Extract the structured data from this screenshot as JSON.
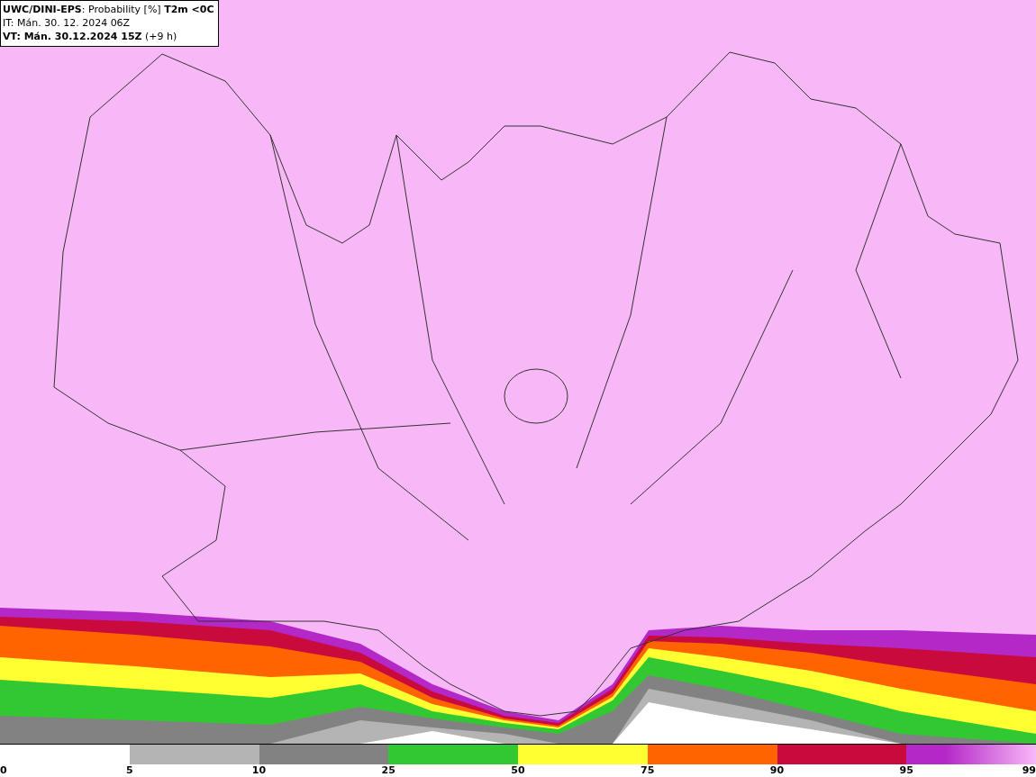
{
  "title": {
    "line_1": "**UWC/DINI-EPS**: Probability [%] **T2m <0C**",
    "line_2": "IT: Mán. 30. 12. 2024 06Z",
    "line_3": "**VT: Mán. 30.12.2024 15Z** (+9 h)"
  },
  "legend": {
    "segments": [
      {
        "color": "#ffffff",
        "kind": "solid"
      },
      {
        "color": "#b4b4b4",
        "kind": "solid"
      },
      {
        "color": "#828282",
        "kind": "solid"
      },
      {
        "color": "#32c832",
        "kind": "solid"
      },
      {
        "color": "#ffff32",
        "kind": "solid"
      },
      {
        "color": "#ff6400",
        "kind": "solid"
      },
      {
        "color": "#c80a3c",
        "kind": "solid"
      },
      {
        "color": "#b428c8",
        "kind": "gradient"
      }
    ],
    "labels": [
      "0",
      "5",
      "10",
      "25",
      "50",
      "75",
      "90",
      "95",
      "99"
    ]
  }
}
